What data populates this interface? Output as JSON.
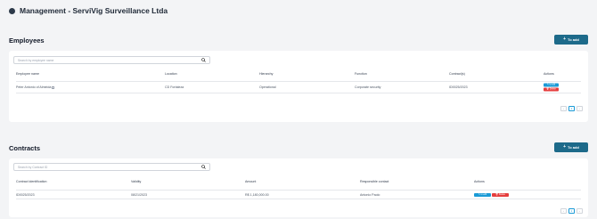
{
  "header": {
    "title": "Management - ServiVig Surveillance Ltda"
  },
  "employees": {
    "section_title": "Employees",
    "add_label": "To add",
    "search_placeholder": "Search by employee name",
    "columns": [
      "Employee name",
      "Location",
      "Hierarchy",
      "Function",
      "Contract(s)",
      "Actions"
    ],
    "rows": [
      {
        "name": "Peter Antonio of Almeida",
        "location": "CD Fortaleza",
        "hierarchy": "Operational",
        "function": "Corporate security",
        "contract": "ID0025/2023",
        "edit": "✎ to edit",
        "delete": "🗑 Delete"
      }
    ],
    "pagination": {
      "prev": "‹",
      "page": "1",
      "next": "›"
    }
  },
  "contracts": {
    "section_title": "Contracts",
    "add_label": "To add",
    "search_placeholder": "Search by Contract ID",
    "columns": [
      "Contract identification",
      "Validity",
      "Amount",
      "Responsible contact",
      "Actions"
    ],
    "rows": [
      {
        "id": "ID0025/2023",
        "validity": "08/21/2023",
        "amount": "R$ 1,180,000.00",
        "contact": "Antonio Paolo",
        "edit": "✎ to edit",
        "delete": "🗑 Delete"
      }
    ],
    "pagination": {
      "prev": "‹",
      "page": "1",
      "next": "›"
    }
  }
}
